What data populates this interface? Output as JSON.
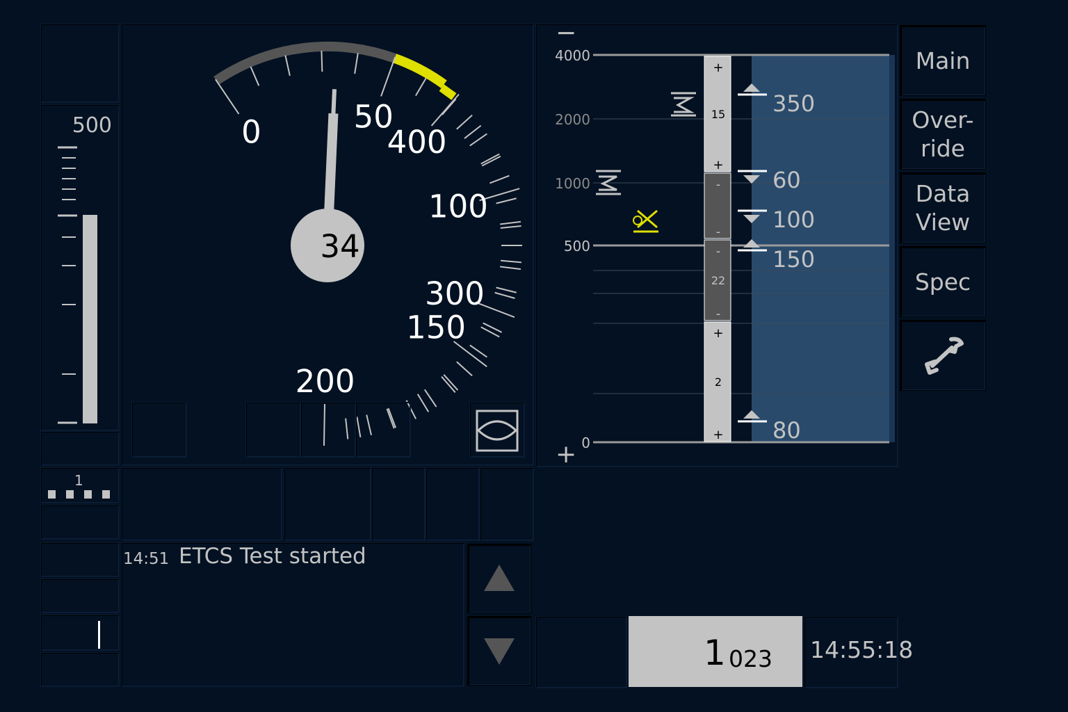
{
  "target_distance": {
    "top_scale_label": "500"
  },
  "level_indicator": {
    "label": "1"
  },
  "speedometer": {
    "dial_labels": [
      "0",
      "50",
      "100",
      "150",
      "200",
      "300",
      "400"
    ],
    "current_speed": "34",
    "speed_value": 34,
    "permitted_speed_value": 80,
    "colors": {
      "arc_yellow": "#dfdf00",
      "arc_grey": "#555555",
      "needle": "#c3c3c3"
    }
  },
  "planning": {
    "distance_labels": [
      "4000",
      "2000",
      "1000",
      "500",
      "0"
    ],
    "zoom_out_symbol": "−",
    "zoom_in_symbol": "+",
    "gradient_segments": [
      {
        "top_sign": "+",
        "value": "15",
        "bottom_sign": "+"
      },
      {
        "top_sign": "-",
        "value": "",
        "bottom_sign": "-"
      },
      {
        "top_sign": "-",
        "value": "22",
        "bottom_sign": "-"
      },
      {
        "top_sign": "+",
        "value": "2",
        "bottom_sign": "+"
      }
    ],
    "speed_targets": [
      {
        "value": "350",
        "direction": "up"
      },
      {
        "value": "60",
        "direction": "down"
      },
      {
        "value": "100",
        "direction": "down"
      },
      {
        "value": "150",
        "direction": "up"
      },
      {
        "value": "80",
        "direction": "up"
      }
    ],
    "pasp_color": "#294a6b"
  },
  "menu": {
    "buttons": [
      {
        "label": "Main"
      },
      {
        "label_line1": "Over-",
        "label_line2": "ride"
      },
      {
        "label_line1": "Data",
        "label_line2": "View"
      },
      {
        "label": "Spec"
      },
      {
        "icon": "wrench-icon"
      }
    ]
  },
  "messages": [
    {
      "time": "14:51",
      "text": "ETCS Test started"
    }
  ],
  "odometer": {
    "big": "1",
    "small": "023"
  },
  "clock": "14:55:18"
}
